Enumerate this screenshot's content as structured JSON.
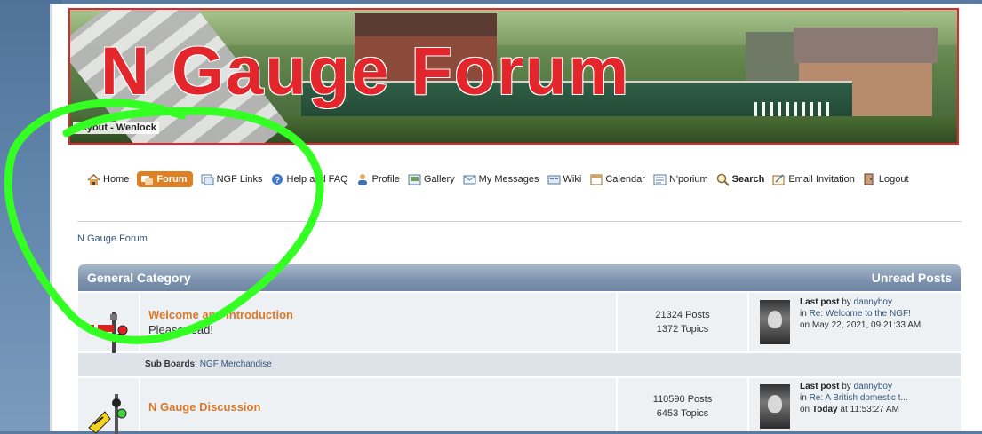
{
  "banner": {
    "title": "N Gauge Forum",
    "caption": "Layout - Wenlock"
  },
  "nav": {
    "items": [
      {
        "label": "Home",
        "icon": "home-icon"
      },
      {
        "label": "Forum",
        "icon": "forum-icon",
        "active": true
      },
      {
        "label": "NGF Links",
        "icon": "links-icon"
      },
      {
        "label": "Help and FAQ",
        "icon": "help-icon"
      },
      {
        "label": "Profile",
        "icon": "profile-icon"
      },
      {
        "label": "Gallery",
        "icon": "gallery-icon"
      },
      {
        "label": "My Messages",
        "icon": "messages-icon"
      },
      {
        "label": "Wiki",
        "icon": "wiki-icon"
      },
      {
        "label": "Calendar",
        "icon": "calendar-icon"
      },
      {
        "label": "N'porium",
        "icon": "nporium-icon"
      },
      {
        "label": "Search",
        "icon": "search-icon",
        "bold": true
      },
      {
        "label": "Email Invitation",
        "icon": "email-icon"
      },
      {
        "label": "Logout",
        "icon": "logout-icon"
      }
    ]
  },
  "breadcrumb": "N Gauge Forum",
  "category": {
    "title": "General Category",
    "unread": "Unread Posts"
  },
  "boards": [
    {
      "title": "Welcome and Introduction",
      "description": "Please read!",
      "posts": "21324 Posts",
      "topics": "1372 Topics",
      "last_post_label": "Last post",
      "by": "by",
      "author": "dannyboy",
      "in": "in",
      "topic": "Re: Welcome to the NGF!",
      "on": "on May 22, 2021, 09:21:33 AM"
    },
    {
      "title": "N Gauge Discussion",
      "description": "",
      "posts": "110590 Posts",
      "topics": "6453 Topics",
      "last_post_label": "Last post",
      "by": "by",
      "author": "dannyboy",
      "in": "in",
      "topic": "Re: A British domestic t...",
      "on_prefix": "on",
      "on_bold": "Today",
      "on_suffix": "at 11:53:27 AM"
    }
  ],
  "subboards": {
    "label": "Sub Boards",
    "sep": ":",
    "items": [
      "NGF Merchandise"
    ]
  },
  "colors": {
    "accent_orange": "#e08024",
    "board_title": "#d97a2b",
    "header_blue": "#7c92ad",
    "banner_red": "#e3262c",
    "annotation_green": "#33ff22"
  }
}
